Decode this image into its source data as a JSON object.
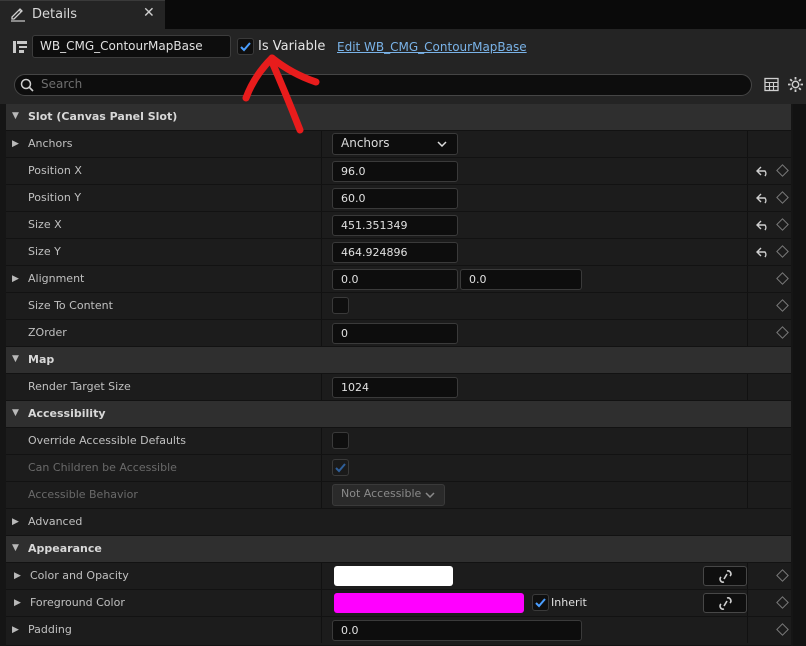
{
  "tab": {
    "title": "Details",
    "close": "✕"
  },
  "header": {
    "widget_name": "WB_CMG_ContourMapBase",
    "is_variable_label": "Is Variable",
    "is_variable_checked": true,
    "edit_link": "Edit WB_CMG_ContourMapBase",
    "search_placeholder": "Search"
  },
  "colors": {
    "accent": "#4a9eff",
    "arrow": "#e81c1c",
    "color_opacity": "#ffffff",
    "foreground": "#ff00ff"
  },
  "sections": {
    "slot": "Slot (Canvas Panel Slot)",
    "map": "Map",
    "accessibility": "Accessibility",
    "advanced": "Advanced",
    "appearance": "Appearance"
  },
  "slot": {
    "anchors_label": "Anchors",
    "anchors_value": "Anchors",
    "pos_x_label": "Position X",
    "pos_x": "96.0",
    "pos_y_label": "Position Y",
    "pos_y": "60.0",
    "size_x_label": "Size X",
    "size_x": "451.351349",
    "size_y_label": "Size Y",
    "size_y": "464.924896",
    "alignment_label": "Alignment",
    "align_x": "0.0",
    "align_y": "0.0",
    "size_to_content_label": "Size To Content",
    "zorder_label": "ZOrder",
    "zorder": "0"
  },
  "map": {
    "rts_label": "Render Target Size",
    "rts": "1024"
  },
  "accessibility": {
    "override_label": "Override Accessible Defaults",
    "children_label": "Can Children be Accessible",
    "behavior_label": "Accessible Behavior",
    "behavior_value": "Not Accessible"
  },
  "appearance": {
    "color_opacity_label": "Color and Opacity",
    "foreground_label": "Foreground Color",
    "inherit_label": "Inherit",
    "padding_label": "Padding",
    "padding_value": "0.0"
  }
}
